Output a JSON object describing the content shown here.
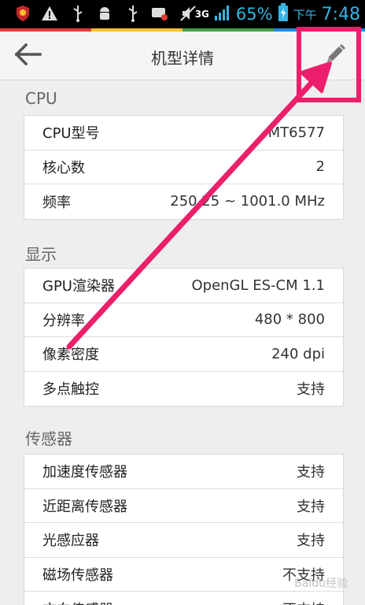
{
  "status_bar": {
    "network_label": "3G",
    "battery": "65%",
    "ampm": "下午",
    "time": "7:48",
    "icons": [
      "shield-icon",
      "warning-icon",
      "usb-icon",
      "android-debug-icon",
      "usb-icon",
      "message-icon",
      "mute-icon",
      "signal-icon",
      "battery-charging-icon"
    ]
  },
  "header": {
    "title": "机型详情",
    "back_icon": "back-arrow-icon",
    "edit_icon": "pencil-icon"
  },
  "sections": [
    {
      "title": "CPU",
      "rows": [
        {
          "label": "CPU型号",
          "value": "MT6577"
        },
        {
          "label": "核心数",
          "value": "2"
        },
        {
          "label": "频率",
          "value": "250.25 ~ 1001.0 MHz"
        }
      ]
    },
    {
      "title": "显示",
      "rows": [
        {
          "label": "GPU渲染器",
          "value": "OpenGL ES-CM 1.1"
        },
        {
          "label": "分辨率",
          "value": "480 * 800"
        },
        {
          "label": "像素密度",
          "value": "240 dpi"
        },
        {
          "label": "多点触控",
          "value": "支持"
        }
      ]
    },
    {
      "title": "传感器",
      "rows": [
        {
          "label": "加速度传感器",
          "value": "支持"
        },
        {
          "label": "近距离传感器",
          "value": "支持"
        },
        {
          "label": "光感应器",
          "value": "支持"
        },
        {
          "label": "磁场传感器",
          "value": "不支持"
        },
        {
          "label": "方向传感器",
          "value": "不支持"
        }
      ]
    }
  ],
  "annotation": {
    "color": "#ec1f6c"
  },
  "watermark": "Baidu经验",
  "colors": {
    "accent": "#33b5e5",
    "strip": [
      "#e53935",
      "#fbc02d",
      "#43a047",
      "#1e88e5"
    ]
  }
}
